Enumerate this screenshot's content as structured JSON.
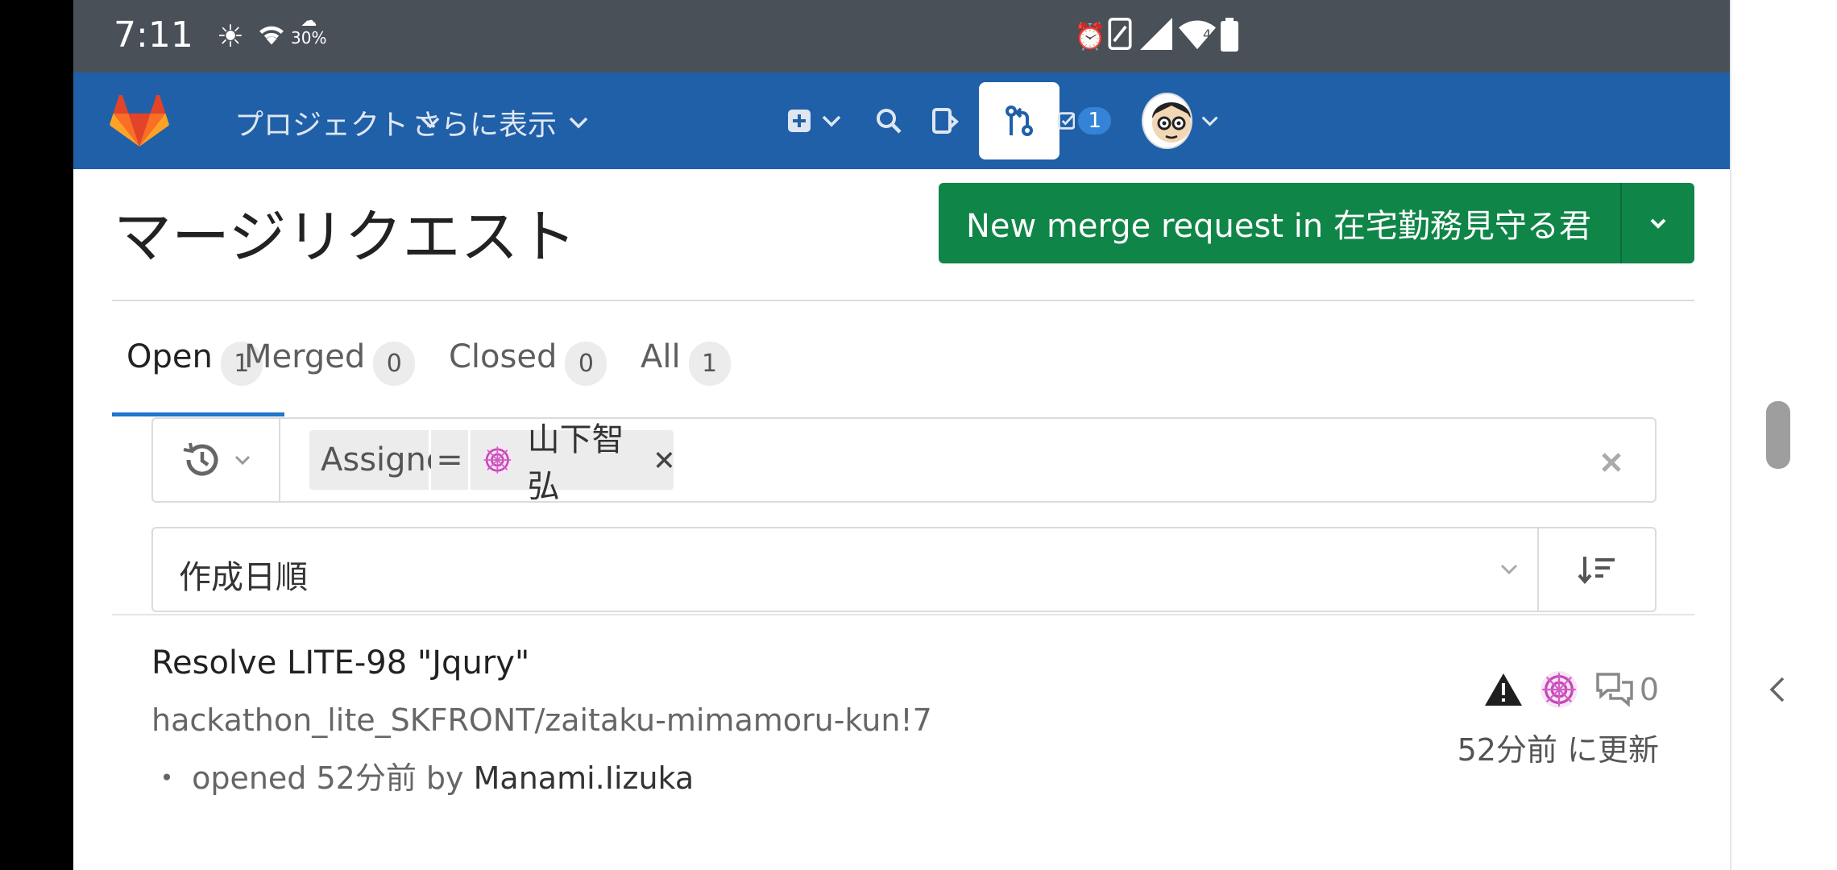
{
  "status_bar": {
    "time": "7:11",
    "weather_percent": "30%",
    "signal_label": "4"
  },
  "navbar": {
    "projects_label": "プロジェクト",
    "more_label": "さらに表示",
    "todo_count": "1",
    "brand_color": "#1f60a8"
  },
  "page": {
    "title": "マージリクエスト",
    "new_mr_button": "New merge request in 在宅勤務見守る君",
    "accent_green": "#108548"
  },
  "tabs": [
    {
      "label": "Open",
      "count": "1"
    },
    {
      "label": "Merged",
      "count": "0"
    },
    {
      "label": "Closed",
      "count": "0"
    },
    {
      "label": "All",
      "count": "1"
    }
  ],
  "filter": {
    "token_key": "Assignee",
    "token_operator": "=",
    "token_value": "山下智弘"
  },
  "sort": {
    "selected": "作成日順"
  },
  "merge_requests": [
    {
      "title": "Resolve LITE-98 \"Jqury\"",
      "reference": "hackathon_lite_SKFRONT/zaitaku-mimamoru-kun!7",
      "opened_prefix": "・ opened 52分前 by",
      "author": "Manami.Iizuka",
      "comments": "0",
      "updated": "52分前 に更新"
    }
  ]
}
